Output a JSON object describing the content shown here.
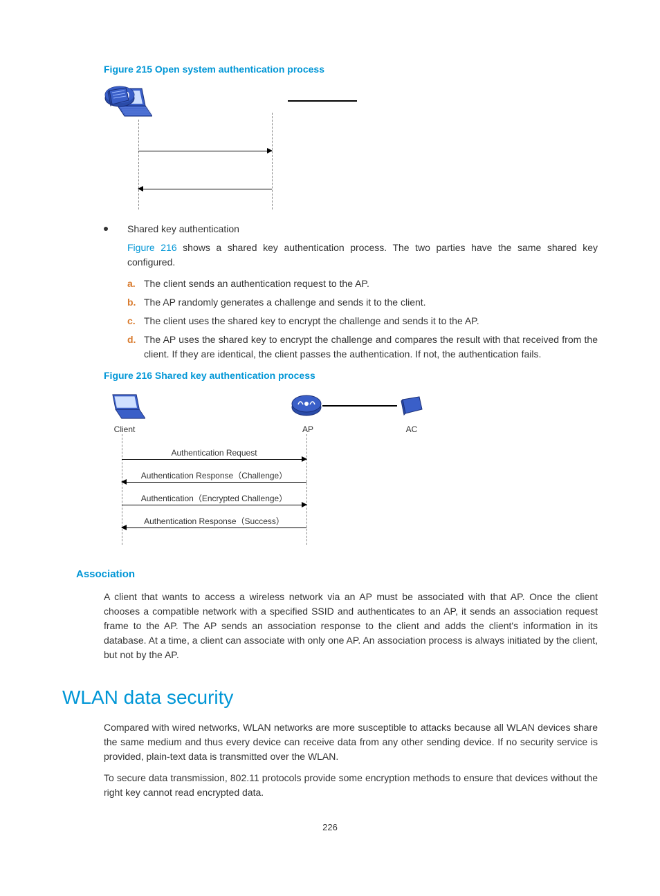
{
  "figure215": {
    "title": "Figure 215 Open system authentication process"
  },
  "sharedKey": {
    "bullet": "Shared key authentication",
    "intro_pre": "Figure 216",
    "intro_post": " shows a shared key authentication process. The two parties have the same shared key configured.",
    "steps": {
      "a": "The client sends an authentication request to the AP.",
      "b": "The AP randomly generates a challenge and sends it to the client.",
      "c": "The client uses the shared key to encrypt the challenge and sends it to the AP.",
      "d": "The AP uses the shared key to encrypt the challenge and compares the result with that received from the client. If they are identical, the client passes the authentication. If not, the authentication fails."
    }
  },
  "figure216": {
    "title": "Figure 216 Shared key authentication process",
    "labels": {
      "client": "Client",
      "ap": "AP",
      "ac": "AC"
    },
    "msgs": {
      "m1": "Authentication Request",
      "m2": "Authentication Response（Challenge）",
      "m3": "Authentication（Encrypted Challenge）",
      "m4": "Authentication Response（Success）"
    }
  },
  "association": {
    "heading": "Association",
    "para": "A client that wants to access a wireless network via an AP must be associated with that AP. Once the client chooses a compatible network with a specified SSID and authenticates to an AP, it sends an association request frame to the AP. The AP sends an association response to the client and adds the client's information in its database. At a time, a client can associate with only one AP. An association process is always initiated by the client, but not by the AP."
  },
  "wlanSecurity": {
    "heading": "WLAN data security",
    "para1": "Compared with wired networks, WLAN networks are more susceptible to attacks because all WLAN devices share the same medium and thus every device can receive data from any other sending device. If no security service is provided, plain-text data is transmitted over the WLAN.",
    "para2": "To secure data transmission, 802.11 protocols provide some encryption methods to ensure that devices without the right key cannot read encrypted data."
  },
  "pageNumber": "226"
}
